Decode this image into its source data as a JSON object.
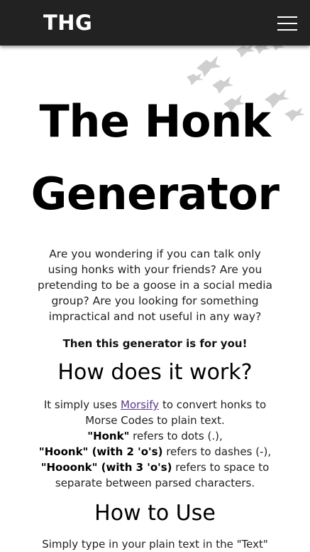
{
  "navbar": {
    "brand": "THG",
    "menu_icon": "hamburger-menu-icon"
  },
  "decoration": {
    "icon": "flying-geese-icon"
  },
  "hero": {
    "title_line1": "The Honk",
    "title_line2": "Generator",
    "intro": "Are you wondering if you can talk only using honks with your friends? Are you pretending to be a goose in a social media group? Are you looking for something impractical and not useful in any way?",
    "cta": "Then this generator is for you!"
  },
  "how_it_works": {
    "heading": "How does it work?",
    "prefix": "It simply uses ",
    "link_text": "Morsify",
    "suffix": " to convert honks to Morse Codes to plain text.",
    "honk_term": "\"Honk\"",
    "honk_desc": " refers to dots (.),",
    "hoonk_term": "\"Hoonk\" (with 2 'o's)",
    "hoonk_desc": " refers to dashes (-),",
    "hooonk_term": "\"Hooonk\" (with 3 'o's)",
    "hooonk_desc": " refers to space to separate between parsed characters."
  },
  "how_to_use": {
    "heading": "How to Use",
    "text": "Simply type in your plain text in the \"Text\""
  },
  "colors": {
    "navbar_bg": "#222222",
    "link": "#5b3b8c"
  }
}
